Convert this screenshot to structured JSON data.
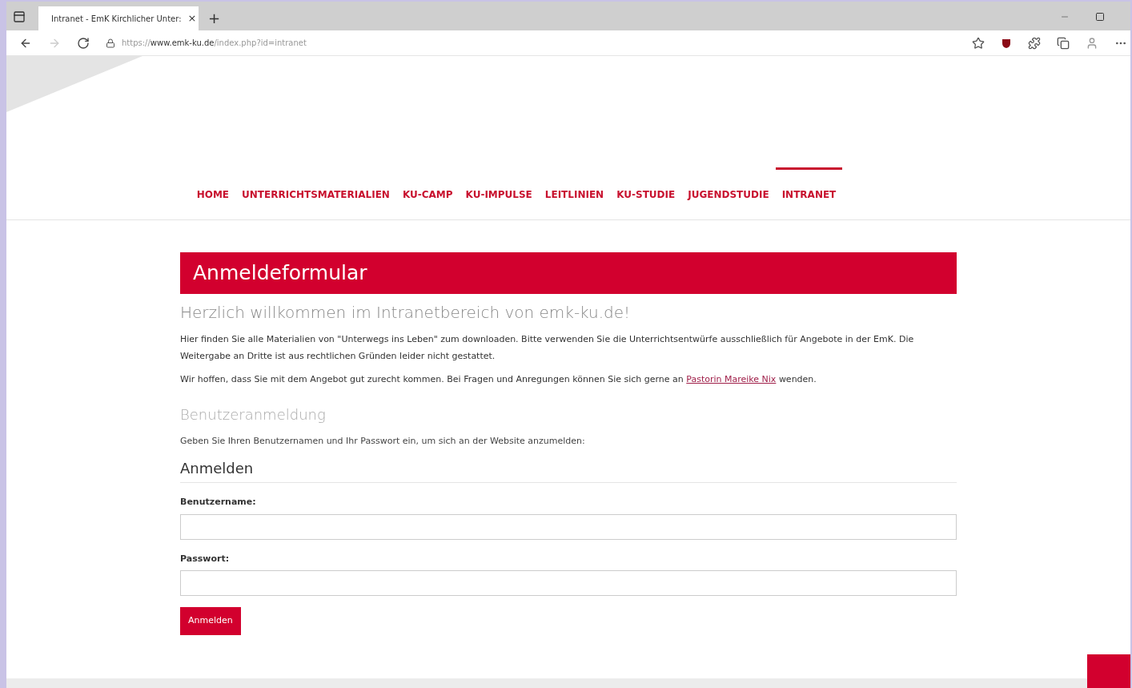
{
  "browser": {
    "tab_title": "Intranet - EmK Kirchlicher Unter:",
    "new_tab": "+",
    "close_tab": "×",
    "url": {
      "scheme": "https://",
      "domain": "www.emk-ku.de",
      "path": "/index.php?id=intranet"
    }
  },
  "nav": [
    {
      "label": "HOME",
      "selected": false
    },
    {
      "label": "UNTERRICHTSMATERIALIEN",
      "selected": false
    },
    {
      "label": "KU-CAMP",
      "selected": false
    },
    {
      "label": "KU-IMPULSE",
      "selected": false
    },
    {
      "label": "LEITLINIEN",
      "selected": false
    },
    {
      "label": "KU-STUDIE",
      "selected": false
    },
    {
      "label": "JUGENDSTUDIE",
      "selected": false
    },
    {
      "label": "INTRANET",
      "selected": true
    }
  ],
  "page": {
    "title": "Anmeldeformular",
    "welcome": "Herzlich willkommen im Intranetbereich von emk-ku.de!",
    "intro": "Hier finden Sie alle Materialien von \"Unterwegs ins Leben\" zum downloaden. Bitte verwenden Sie die Unterrichtsentwürfe ausschließlich für Angebote in der EmK. Die Weitergabe an Dritte ist aus rechtlichen Gründen leider nicht gestattet.",
    "contact": {
      "before": "Wir hoffen, dass Sie mit dem Angebot gut zurecht kommen. Bei Fragen und Anregungen können Sie sich gerne an",
      "link": "Pastorin Mareike Nix",
      "after": "wenden."
    }
  },
  "login": {
    "heading": "Benutzeranmeldung",
    "hint": "Geben Sie Ihren Benutzernamen und Ihr Passwort ein, um sich an der Website anzumelden:",
    "form_title": "Anmelden",
    "fields": [
      {
        "label": "Benutzername:"
      },
      {
        "label": "Passwort:"
      }
    ],
    "submit": "Anmelden"
  }
}
